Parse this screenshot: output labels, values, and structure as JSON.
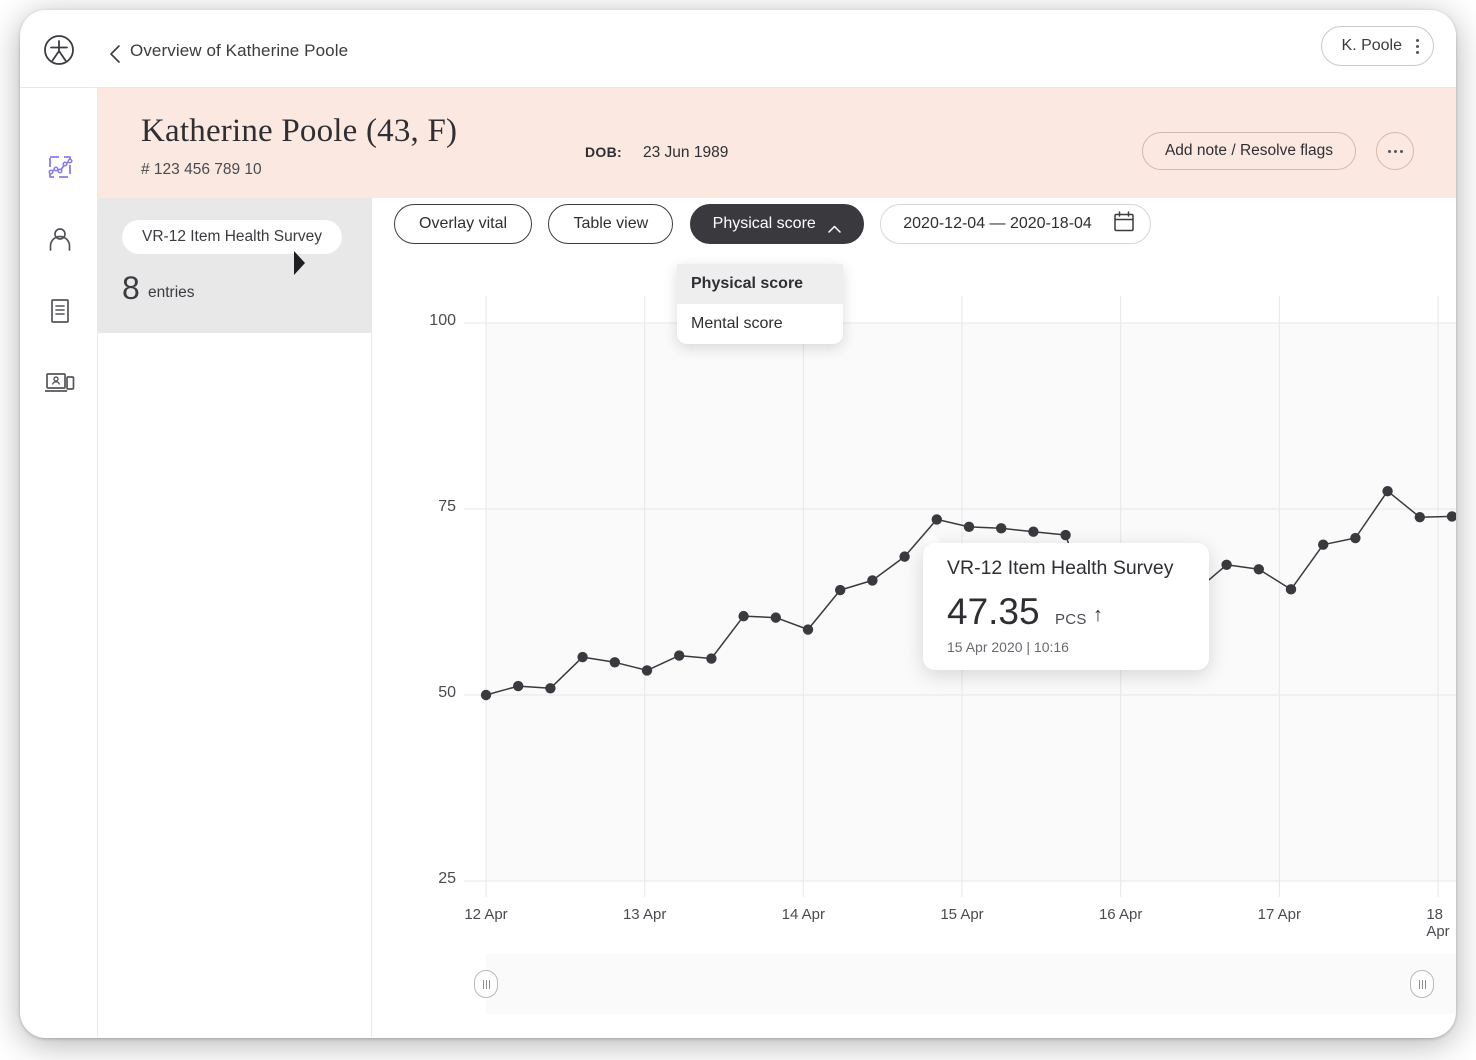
{
  "topbar": {
    "logo_icon": "clinic-logo-icon",
    "back_icon": "chevron-left-icon",
    "breadcrumb": "Overview of Katherine Poole",
    "user_name": "K. Poole",
    "user_menu_icon": "kebab-vertical-icon"
  },
  "rail": {
    "items": [
      {
        "icon": "chart-trend-icon",
        "name": "sidebar-item-charts",
        "active": true
      },
      {
        "icon": "person-icon",
        "name": "sidebar-item-patients",
        "active": false
      },
      {
        "icon": "document-icon",
        "name": "sidebar-item-records",
        "active": false
      },
      {
        "icon": "telehealth-monitor-icon",
        "name": "sidebar-item-telehealth",
        "active": false
      }
    ],
    "accent": "#8b7bf0"
  },
  "banner": {
    "patient_name": "Katherine Poole (43,  F)",
    "patient_id": "# 123 456 789 10",
    "dob_label": "DOB:",
    "dob_value": "23 Jun 1989",
    "add_note_label": "Add note / Resolve flags",
    "more_icon": "ellipsis-horizontal-icon",
    "background": "#fbe8e0"
  },
  "left_panel": {
    "survey_chip": "VR-12 Item Health Survey",
    "entries_count": "8",
    "entries_label": "entries"
  },
  "toolbar": {
    "overlay_vital": "Overlay vital",
    "table_view": "Table view",
    "score_selector": "Physical score",
    "score_chevron_icon": "chevron-up-icon",
    "date_range": "2020-12-04 — 2020-18-04",
    "calendar_icon": "calendar-icon"
  },
  "dropdown": {
    "open": true,
    "options": [
      {
        "label": "Physical score",
        "selected": true
      },
      {
        "label": "Mental score",
        "selected": false
      }
    ]
  },
  "tooltip": {
    "title": "VR-12 Item Health Survey",
    "value": "47.35",
    "unit": "PCS",
    "trend_icon": "arrow-up-icon",
    "datetime": "15 Apr 2020 | 10:16"
  },
  "brush": {
    "left_handle_icon": "grip-handle-icon",
    "right_handle_icon": "grip-handle-icon"
  },
  "chart_data": {
    "type": "line",
    "title": "",
    "xlabel": "",
    "ylabel": "",
    "ylim": [
      25,
      100
    ],
    "yticks": [
      100,
      75,
      50,
      25
    ],
    "xticks": [
      "12 Apr",
      "13 Apr",
      "14 Apr",
      "15 Apr",
      "16 Apr",
      "17 Apr",
      "18 Apr"
    ],
    "grid": true,
    "legend": "none",
    "line_color": "#3a3a3e",
    "point_color": "#3a3a3e",
    "series": [
      {
        "name": "Physical score (PCS)",
        "x": [
          "12 Apr 00:00",
          "12 Apr 04:30",
          "12 Apr 09:00",
          "12 Apr 13:30",
          "12 Apr 18:00",
          "12 Apr 22:30",
          "13 Apr 03:00",
          "13 Apr 07:30",
          "13 Apr 12:00",
          "13 Apr 16:30",
          "13 Apr 21:00",
          "14 Apr 01:30",
          "14 Apr 06:00",
          "14 Apr 10:30",
          "14 Apr 15:00",
          "14 Apr 19:30",
          "15 Apr 00:00",
          "15 Apr 10:16",
          "15 Apr 14:00",
          "16 Apr 12:00",
          "16 Apr 17:00",
          "16 Apr 21:30",
          "17 Apr 02:00",
          "17 Apr 06:30",
          "17 Apr 11:00",
          "17 Apr 15:30",
          "17 Apr 20:00",
          "18 Apr 00:30",
          "18 Apr 05:00",
          "18 Apr 09:30",
          "18 Apr 14:00"
        ],
        "values": [
          50.0,
          51.2,
          50.9,
          55.1,
          54.4,
          53.3,
          55.3,
          54.9,
          60.6,
          60.4,
          58.8,
          64.1,
          65.4,
          68.6,
          73.6,
          72.6,
          72.4,
          47.35,
          71.5,
          59.0,
          60.6,
          60.3,
          63.8,
          67.5,
          66.9,
          64.2,
          70.2,
          71.1,
          77.4,
          73.9,
          74.0
        ]
      }
    ]
  }
}
